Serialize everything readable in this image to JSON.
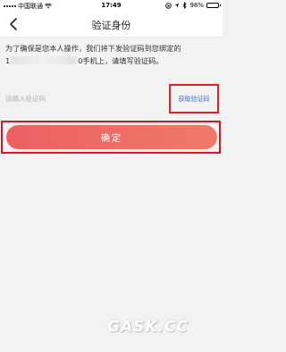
{
  "status_bar": {
    "carrier": "中国联通",
    "time": "17:49",
    "battery": "98%",
    "battery_level": 0.98
  },
  "nav": {
    "title": "验证身份"
  },
  "description": {
    "line1": "为了确保是您本人操作，我们将下发验证码到您绑定的",
    "line2_prefix": "1",
    "line2_suffix": "0手机上，请填写验证码。"
  },
  "code_field": {
    "placeholder": "请输入验证码",
    "value": ""
  },
  "get_code_label": "获取验证码",
  "confirm_label": "确定",
  "watermark": "GASK.CC",
  "colors": {
    "accent_red": "#e0202a",
    "link_blue": "#3a6fd8",
    "button_gradient_start": "#ec6062",
    "button_gradient_end": "#ef7a69"
  }
}
